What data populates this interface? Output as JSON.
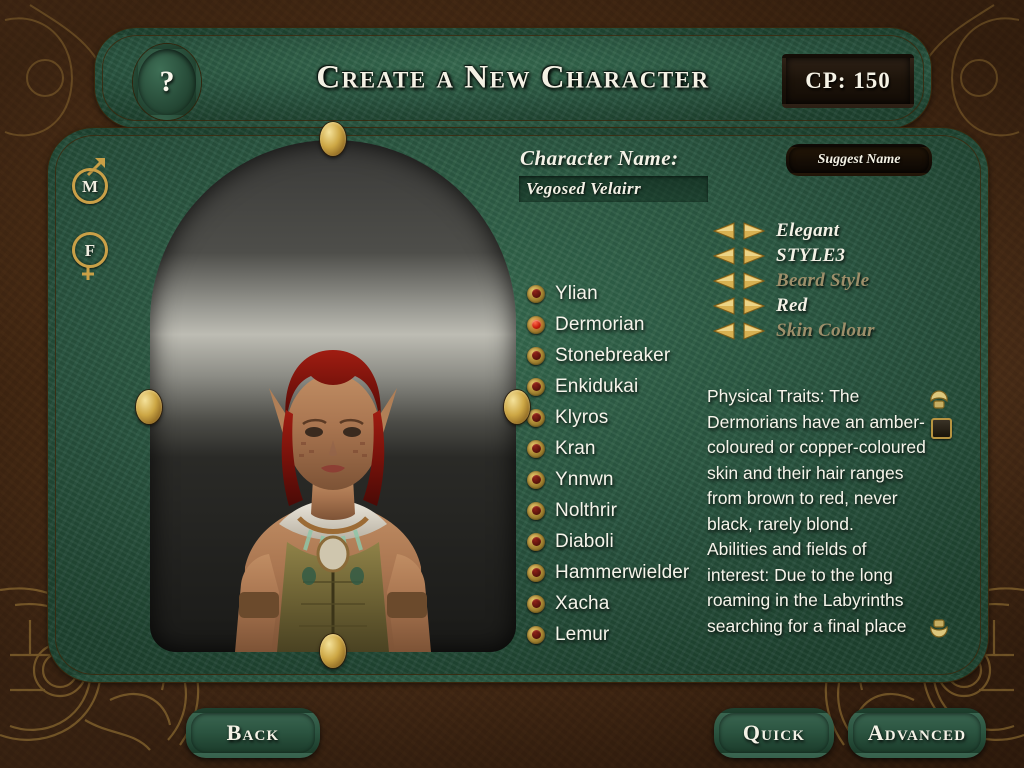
{
  "header": {
    "title": "Create a New Character",
    "help_glyph": "?",
    "cp_label": "CP: 150"
  },
  "gender": {
    "male_letter": "M",
    "female_letter": "F"
  },
  "name_section": {
    "label": "Character Name:",
    "value": "Vegosed Velairr",
    "placeholder": "Vegosed Velairr",
    "suggest_button": "Suggest Name"
  },
  "selectors": [
    {
      "label": "Elegant",
      "enabled": true
    },
    {
      "label": "STYLE3",
      "enabled": true
    },
    {
      "label": "Beard Style",
      "enabled": false
    },
    {
      "label": "Red",
      "enabled": true
    },
    {
      "label": "Skin Colour",
      "enabled": false
    }
  ],
  "races": [
    {
      "name": "Ylian",
      "selected": false
    },
    {
      "name": "Dermorian",
      "selected": true
    },
    {
      "name": "Stonebreaker",
      "selected": false
    },
    {
      "name": "Enkidukai",
      "selected": false
    },
    {
      "name": "Klyros",
      "selected": false
    },
    {
      "name": "Kran",
      "selected": false
    },
    {
      "name": "Ynnwn",
      "selected": false
    },
    {
      "name": "Nolthrir",
      "selected": false
    },
    {
      "name": "Diaboli",
      "selected": false
    },
    {
      "name": "Hammerwielder",
      "selected": false
    },
    {
      "name": "Xacha",
      "selected": false
    },
    {
      "name": "Lemur",
      "selected": false
    }
  ],
  "description": {
    "text": "Physical Traits: The Dermorians have an amber-coloured or copper-coloured skin and their hair ranges from brown to red, never black, rarely blond.\nAbilities and fields of interest: Due to the long roaming in the Labyrinths searching for a final place"
  },
  "footer": {
    "back": "Back",
    "quick": "Quick",
    "advanced": "Advanced"
  },
  "colors": {
    "gold": "#cfa53f",
    "gold_light": "#f2dd92",
    "panel_green": "#2a5741",
    "background_brown": "#4a2d15",
    "text_cream": "#f6f4ea",
    "text_dim": "#9d8f6a",
    "gem_red_selected": "#c9200f"
  }
}
